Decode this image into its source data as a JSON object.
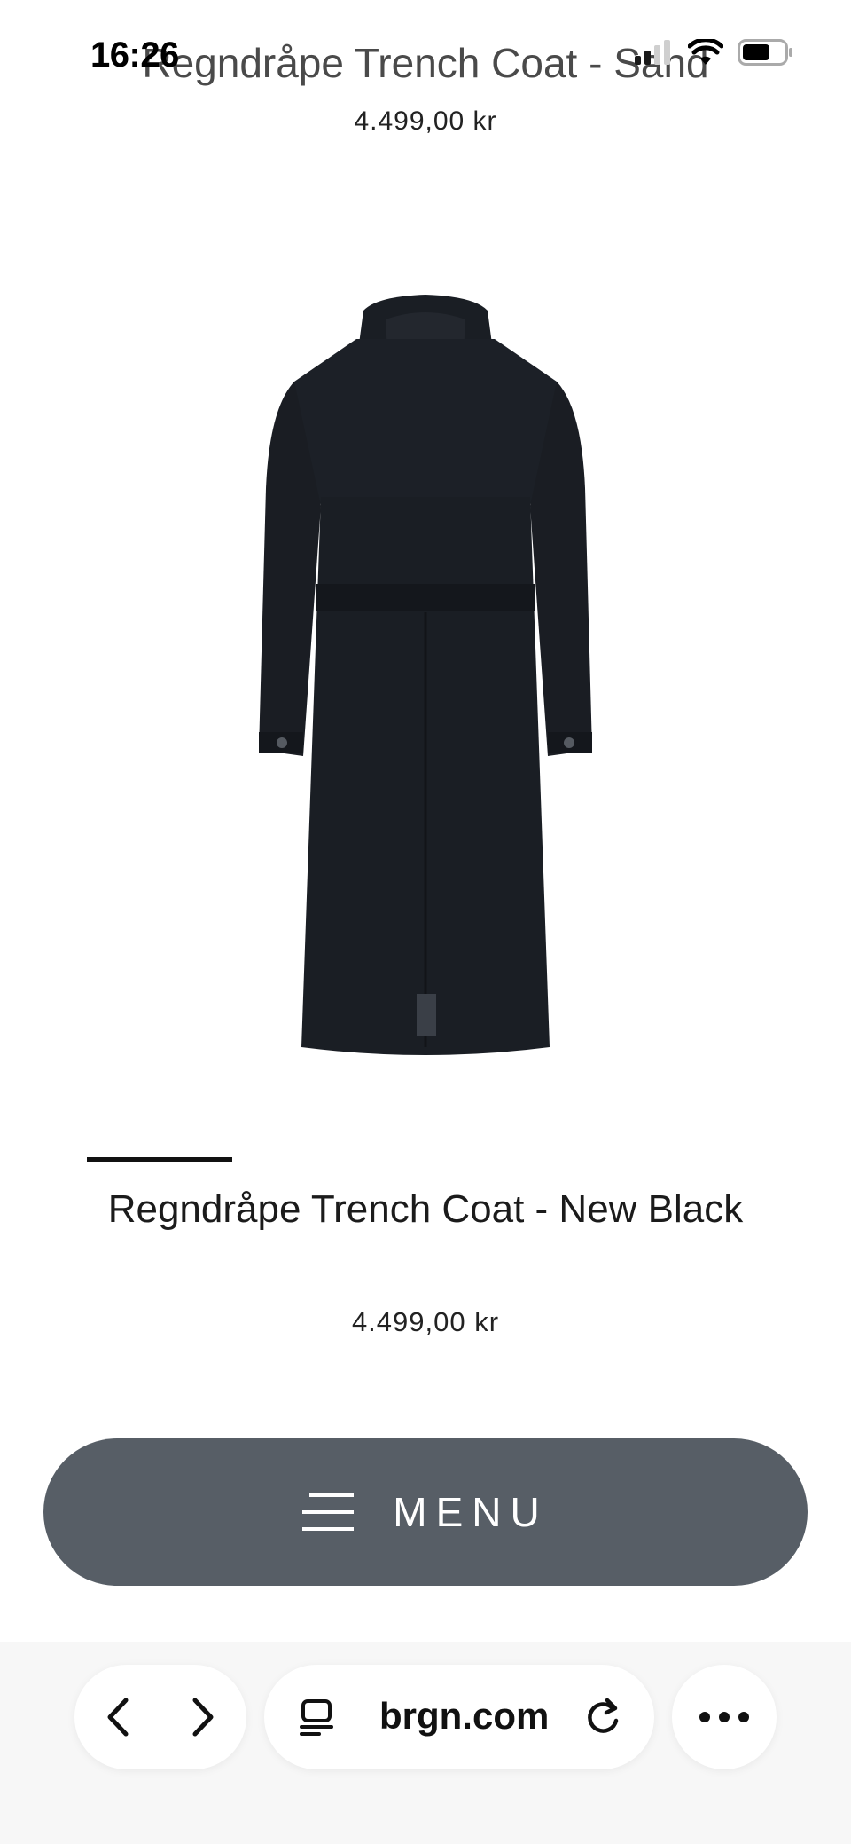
{
  "status": {
    "time": "16:26"
  },
  "previous_product": {
    "title": "Regndråpe Trench Coat - Sand",
    "price": "4.499,00 kr"
  },
  "product": {
    "title": "Regndråpe Trench Coat - New Black",
    "price": "4.499,00 kr"
  },
  "menu": {
    "label": "MENU"
  },
  "browser": {
    "url": "brgn.com"
  },
  "icons": {
    "status": [
      "signal-icon",
      "wifi-icon",
      "battery-icon"
    ],
    "browser": [
      "chevron-left-icon",
      "chevron-right-icon",
      "page-menu-icon",
      "reload-icon",
      "more-icon"
    ],
    "menu": "hamburger-icon"
  },
  "colors": {
    "menu_button": "#575e66",
    "text": "#1b1b1b"
  }
}
